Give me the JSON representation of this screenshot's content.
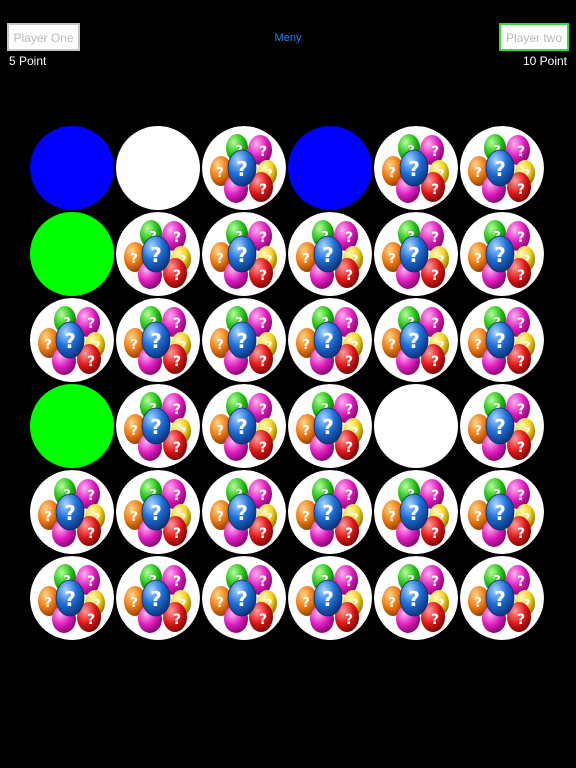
{
  "header": {
    "player_one": {
      "label": "Player One",
      "score": "5 Point"
    },
    "player_two": {
      "label": "Player two",
      "score": "10 Point"
    },
    "menu_label": "Meny"
  },
  "colors": {
    "background": "#000000",
    "menu_link": "#1f86f0",
    "player_two_highlight": "#38d838",
    "player_one_border": "#c6c6c6",
    "card_blue": "#0000ff",
    "card_green": "#00ff00",
    "card_white": "#ffffff"
  },
  "board": {
    "rows": 6,
    "cols": 6,
    "hidden_icon": "easter-eggs-question-icon",
    "cells": [
      [
        "blue",
        "white",
        "hidden",
        "blue",
        "hidden",
        "hidden"
      ],
      [
        "green",
        "hidden",
        "hidden",
        "hidden",
        "hidden",
        "hidden"
      ],
      [
        "hidden",
        "hidden",
        "hidden",
        "hidden",
        "hidden",
        "hidden"
      ],
      [
        "green",
        "hidden",
        "hidden",
        "hidden",
        "white",
        "hidden"
      ],
      [
        "hidden",
        "hidden",
        "hidden",
        "hidden",
        "hidden",
        "hidden"
      ],
      [
        "hidden",
        "hidden",
        "hidden",
        "hidden",
        "hidden",
        "hidden"
      ]
    ]
  }
}
